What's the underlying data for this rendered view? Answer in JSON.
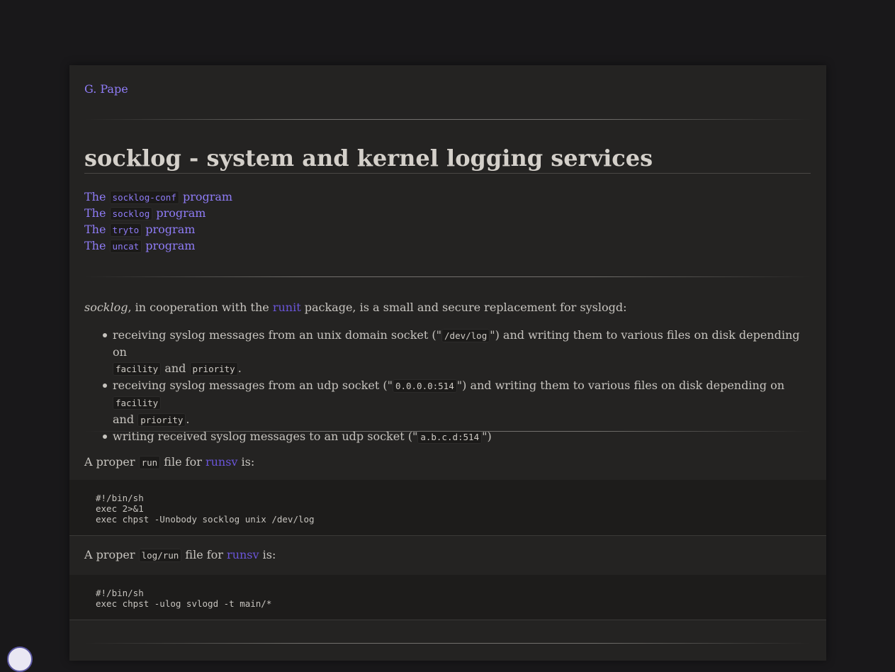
{
  "header": {
    "author_link": "G. Pape"
  },
  "title": "socklog - system and kernel logging services",
  "toc": [
    {
      "prefix": "The",
      "code": "socklog-conf",
      "suffix": "program"
    },
    {
      "prefix": "The",
      "code": "socklog",
      "suffix": "program"
    },
    {
      "prefix": "The",
      "code": "tryto",
      "suffix": "program"
    },
    {
      "prefix": "The",
      "code": "uncat",
      "suffix": "program"
    }
  ],
  "intro": {
    "emph": "socklog",
    "text1": ", in cooperation with the",
    "link": "runit",
    "text2": "package, is a small and secure replacement for syslogd:"
  },
  "features": [
    {
      "t1": "receiving syslog messages from an unix domain socket (\"",
      "c1": "/dev/log",
      "t2": "\") and writing them to various files on disk depending on",
      "c2": "facility",
      "t3": "and",
      "c3": "priority",
      "t4": "."
    },
    {
      "t1": "receiving syslog messages from an udp socket (\"",
      "c1": "0.0.0.0:514",
      "t2": "\") and writing them to various files on disk depending on",
      "c2": "facility",
      "t3": "and",
      "c3": "priority",
      "t4": "."
    },
    {
      "t1": "writing received syslog messages to an udp socket (\"",
      "c1": "a.b.c.d:514",
      "t2": "\")"
    }
  ],
  "run_section": {
    "text1": "A proper",
    "code": "run",
    "text2": "file for",
    "link": "runsv",
    "text3": "is:",
    "script": "#!/bin/sh\nexec 2>&1\nexec chpst -Unobody socklog unix /dev/log"
  },
  "logrun_section": {
    "text1": "A proper",
    "code": "log/run",
    "text2": "file for",
    "link": "runsv",
    "text3": "is:",
    "script": "#!/bin/sh\nexec chpst -ulog svlogd -t main/*"
  }
}
